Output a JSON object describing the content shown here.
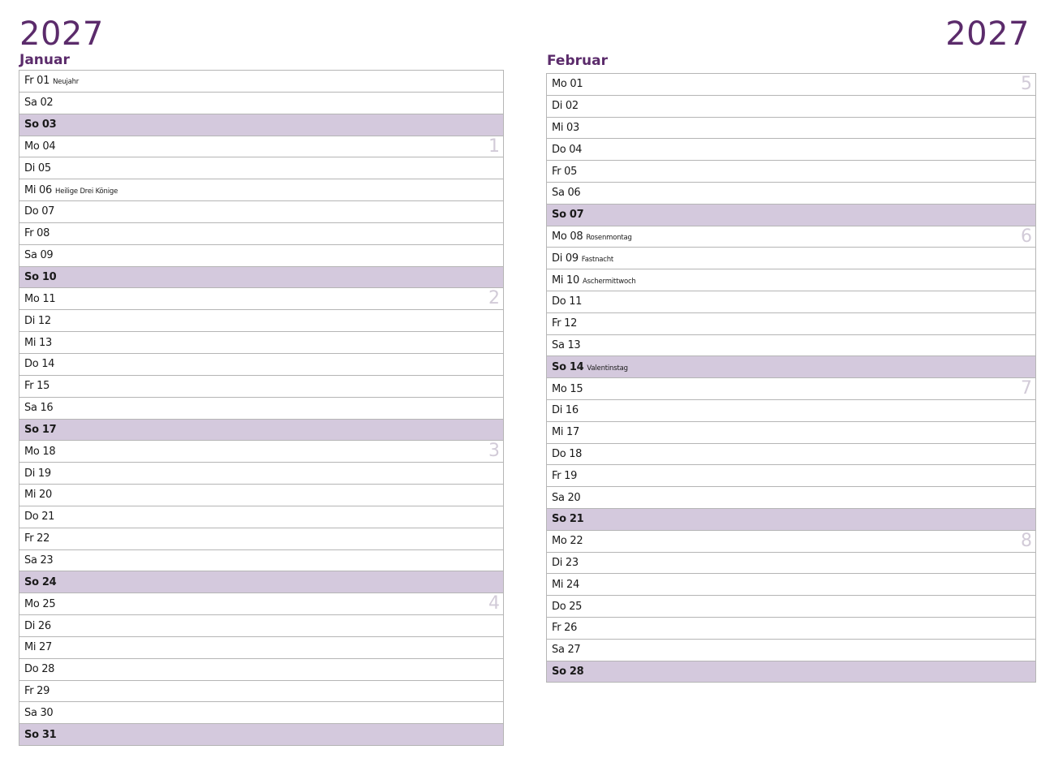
{
  "year_left": "2027",
  "year_right": "2027",
  "months": [
    {
      "name": "Januar",
      "days": [
        {
          "label": "Fr 01",
          "holiday": "Neujahr",
          "sunday": false,
          "week": ""
        },
        {
          "label": "Sa 02",
          "holiday": "",
          "sunday": false,
          "week": ""
        },
        {
          "label": "So 03",
          "holiday": "",
          "sunday": true,
          "week": ""
        },
        {
          "label": "Mo 04",
          "holiday": "",
          "sunday": false,
          "week": "1"
        },
        {
          "label": "Di 05",
          "holiday": "",
          "sunday": false,
          "week": ""
        },
        {
          "label": "Mi 06",
          "holiday": "Heilige Drei Könige",
          "sunday": false,
          "week": ""
        },
        {
          "label": "Do 07",
          "holiday": "",
          "sunday": false,
          "week": ""
        },
        {
          "label": "Fr 08",
          "holiday": "",
          "sunday": false,
          "week": ""
        },
        {
          "label": "Sa 09",
          "holiday": "",
          "sunday": false,
          "week": ""
        },
        {
          "label": "So 10",
          "holiday": "",
          "sunday": true,
          "week": ""
        },
        {
          "label": "Mo 11",
          "holiday": "",
          "sunday": false,
          "week": "2"
        },
        {
          "label": "Di 12",
          "holiday": "",
          "sunday": false,
          "week": ""
        },
        {
          "label": "Mi 13",
          "holiday": "",
          "sunday": false,
          "week": ""
        },
        {
          "label": "Do 14",
          "holiday": "",
          "sunday": false,
          "week": ""
        },
        {
          "label": "Fr 15",
          "holiday": "",
          "sunday": false,
          "week": ""
        },
        {
          "label": "Sa 16",
          "holiday": "",
          "sunday": false,
          "week": ""
        },
        {
          "label": "So 17",
          "holiday": "",
          "sunday": true,
          "week": ""
        },
        {
          "label": "Mo 18",
          "holiday": "",
          "sunday": false,
          "week": "3"
        },
        {
          "label": "Di 19",
          "holiday": "",
          "sunday": false,
          "week": ""
        },
        {
          "label": "Mi 20",
          "holiday": "",
          "sunday": false,
          "week": ""
        },
        {
          "label": "Do 21",
          "holiday": "",
          "sunday": false,
          "week": ""
        },
        {
          "label": "Fr 22",
          "holiday": "",
          "sunday": false,
          "week": ""
        },
        {
          "label": "Sa 23",
          "holiday": "",
          "sunday": false,
          "week": ""
        },
        {
          "label": "So 24",
          "holiday": "",
          "sunday": true,
          "week": ""
        },
        {
          "label": "Mo 25",
          "holiday": "",
          "sunday": false,
          "week": "4"
        },
        {
          "label": "Di 26",
          "holiday": "",
          "sunday": false,
          "week": ""
        },
        {
          "label": "Mi 27",
          "holiday": "",
          "sunday": false,
          "week": ""
        },
        {
          "label": "Do 28",
          "holiday": "",
          "sunday": false,
          "week": ""
        },
        {
          "label": "Fr 29",
          "holiday": "",
          "sunday": false,
          "week": ""
        },
        {
          "label": "Sa 30",
          "holiday": "",
          "sunday": false,
          "week": ""
        },
        {
          "label": "So 31",
          "holiday": "",
          "sunday": true,
          "week": ""
        }
      ]
    },
    {
      "name": "Februar",
      "days": [
        {
          "label": "Mo 01",
          "holiday": "",
          "sunday": false,
          "week": "5"
        },
        {
          "label": "Di 02",
          "holiday": "",
          "sunday": false,
          "week": ""
        },
        {
          "label": "Mi 03",
          "holiday": "",
          "sunday": false,
          "week": ""
        },
        {
          "label": "Do 04",
          "holiday": "",
          "sunday": false,
          "week": ""
        },
        {
          "label": "Fr 05",
          "holiday": "",
          "sunday": false,
          "week": ""
        },
        {
          "label": "Sa 06",
          "holiday": "",
          "sunday": false,
          "week": ""
        },
        {
          "label": "So 07",
          "holiday": "",
          "sunday": true,
          "week": ""
        },
        {
          "label": "Mo 08",
          "holiday": "Rosenmontag",
          "sunday": false,
          "week": "6"
        },
        {
          "label": "Di 09",
          "holiday": "Fastnacht",
          "sunday": false,
          "week": ""
        },
        {
          "label": "Mi 10",
          "holiday": "Aschermittwoch",
          "sunday": false,
          "week": ""
        },
        {
          "label": "Do 11",
          "holiday": "",
          "sunday": false,
          "week": ""
        },
        {
          "label": "Fr 12",
          "holiday": "",
          "sunday": false,
          "week": ""
        },
        {
          "label": "Sa 13",
          "holiday": "",
          "sunday": false,
          "week": ""
        },
        {
          "label": "So 14",
          "holiday": "Valentinstag",
          "sunday": true,
          "week": ""
        },
        {
          "label": "Mo 15",
          "holiday": "",
          "sunday": false,
          "week": "7"
        },
        {
          "label": "Di 16",
          "holiday": "",
          "sunday": false,
          "week": ""
        },
        {
          "label": "Mi 17",
          "holiday": "",
          "sunday": false,
          "week": ""
        },
        {
          "label": "Do 18",
          "holiday": "",
          "sunday": false,
          "week": ""
        },
        {
          "label": "Fr 19",
          "holiday": "",
          "sunday": false,
          "week": ""
        },
        {
          "label": "Sa 20",
          "holiday": "",
          "sunday": false,
          "week": ""
        },
        {
          "label": "So 21",
          "holiday": "",
          "sunday": true,
          "week": ""
        },
        {
          "label": "Mo 22",
          "holiday": "",
          "sunday": false,
          "week": "8"
        },
        {
          "label": "Di 23",
          "holiday": "",
          "sunday": false,
          "week": ""
        },
        {
          "label": "Mi 24",
          "holiday": "",
          "sunday": false,
          "week": ""
        },
        {
          "label": "Do 25",
          "holiday": "",
          "sunday": false,
          "week": ""
        },
        {
          "label": "Fr 26",
          "holiday": "",
          "sunday": false,
          "week": ""
        },
        {
          "label": "Sa 27",
          "holiday": "",
          "sunday": false,
          "week": ""
        },
        {
          "label": "So 28",
          "holiday": "",
          "sunday": true,
          "week": ""
        }
      ]
    }
  ],
  "colors": {
    "accent": "#5b2b6b",
    "sunday_fill": "#d4c9dd",
    "week_number": "#d2cbd8",
    "grid_line": "#b5b5b5"
  }
}
